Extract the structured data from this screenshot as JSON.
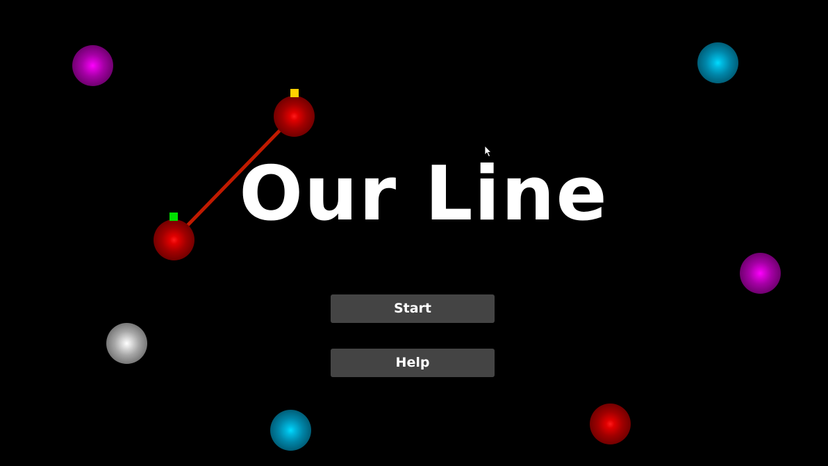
{
  "title": "Our Line",
  "menu": {
    "start_label": "Start",
    "help_label": "Help"
  },
  "colors": {
    "background": "#000000",
    "button_bg": "#444444",
    "title_text": "#ffffff",
    "line": "#c01a00",
    "marker_start": "#00e000",
    "marker_end": "#ffd000",
    "orb_magenta": "#ff00ff",
    "orb_cyan": "#00ddff",
    "orb_red": "#ff1a1a",
    "orb_white": "#ffffff"
  },
  "orbs": [
    {
      "color": "magenta",
      "role": "decorative"
    },
    {
      "color": "cyan",
      "role": "decorative"
    },
    {
      "color": "red",
      "role": "line-endpoint"
    },
    {
      "color": "red",
      "role": "line-endpoint"
    },
    {
      "color": "magenta",
      "role": "decorative"
    },
    {
      "color": "white",
      "role": "decorative"
    },
    {
      "color": "cyan",
      "role": "decorative"
    },
    {
      "color": "red",
      "role": "decorative"
    }
  ]
}
